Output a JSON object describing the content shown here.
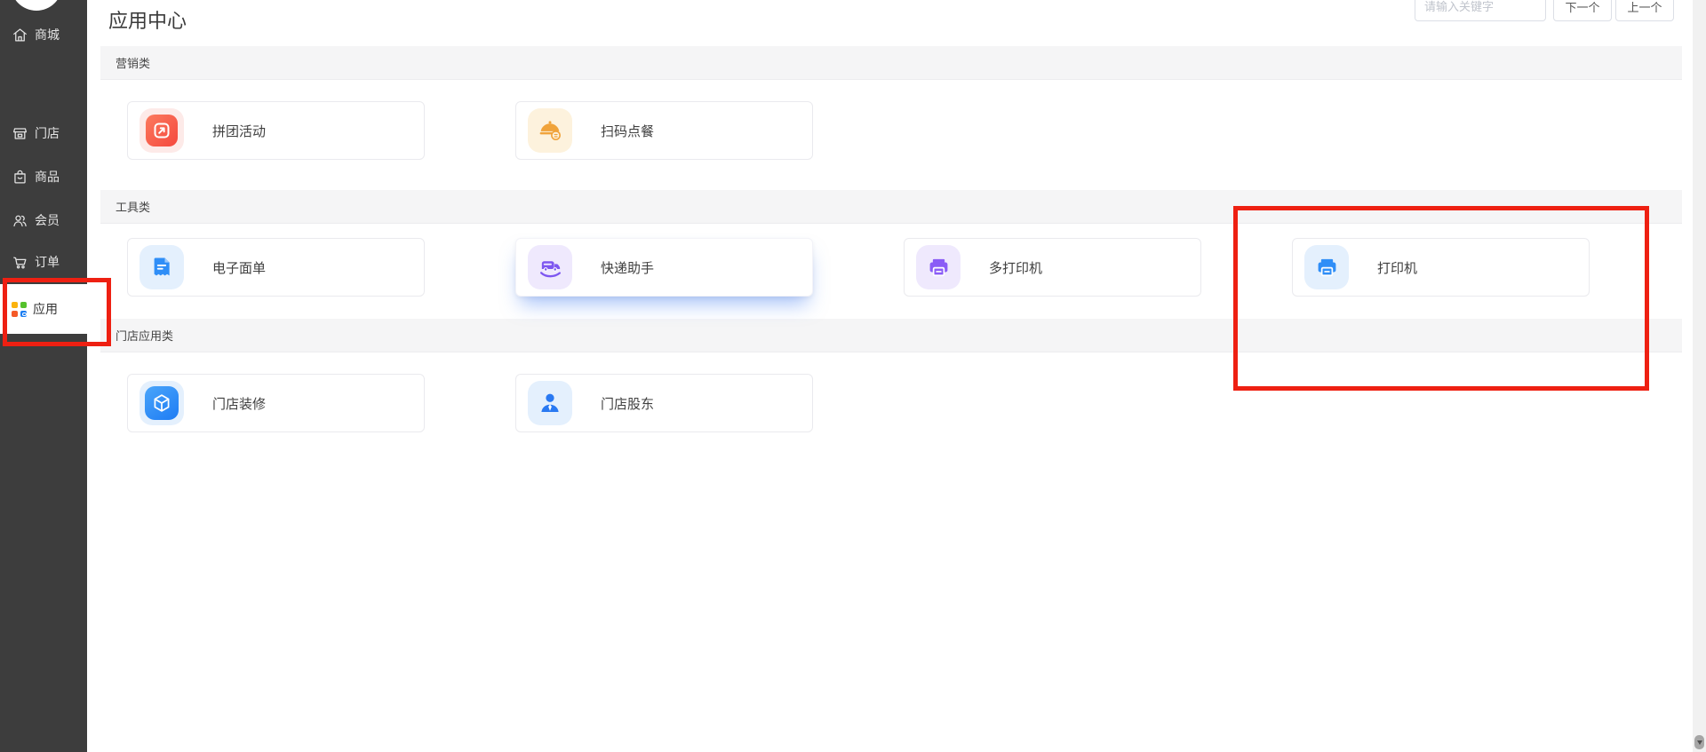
{
  "page_title": "应用中心",
  "sidebar": {
    "items": [
      {
        "label": "商城",
        "icon": "mall-home-icon"
      },
      {
        "label": "门店",
        "icon": "store-icon"
      },
      {
        "label": "商品",
        "icon": "goods-icon"
      },
      {
        "label": "会员",
        "icon": "members-icon"
      },
      {
        "label": "订单",
        "icon": "orders-cart-icon"
      },
      {
        "label": "应用",
        "icon": "apps-grid-icon",
        "active": true
      }
    ]
  },
  "toolbar": {
    "search_placeholder": "请输入关键字",
    "next_label": "下一个",
    "prev_label": "上一个"
  },
  "sections": [
    {
      "title": "营销类",
      "apps": [
        {
          "name": "拼团活动"
        },
        {
          "name": "扫码点餐"
        }
      ]
    },
    {
      "title": "工具类",
      "apps": [
        {
          "name": "电子面单"
        },
        {
          "name": "快递助手",
          "hovered": true
        },
        {
          "name": "多打印机"
        },
        {
          "name": "打印机"
        }
      ]
    },
    {
      "title": "门店应用类",
      "apps": [
        {
          "name": "门店装修"
        },
        {
          "name": "门店股东"
        }
      ]
    }
  ],
  "annotations": {
    "color": "#ee2012",
    "boxes": [
      "sidebar-apps-item",
      "printer-card-region"
    ]
  },
  "colors": {
    "sidebar_bg": "#3d3d3d",
    "section_bar_bg": "#f5f5f6",
    "accent_red": "#f5483e",
    "accent_orange": "#f0a33a",
    "accent_blue": "#2f8ef7",
    "accent_purple": "#7e57f0"
  }
}
